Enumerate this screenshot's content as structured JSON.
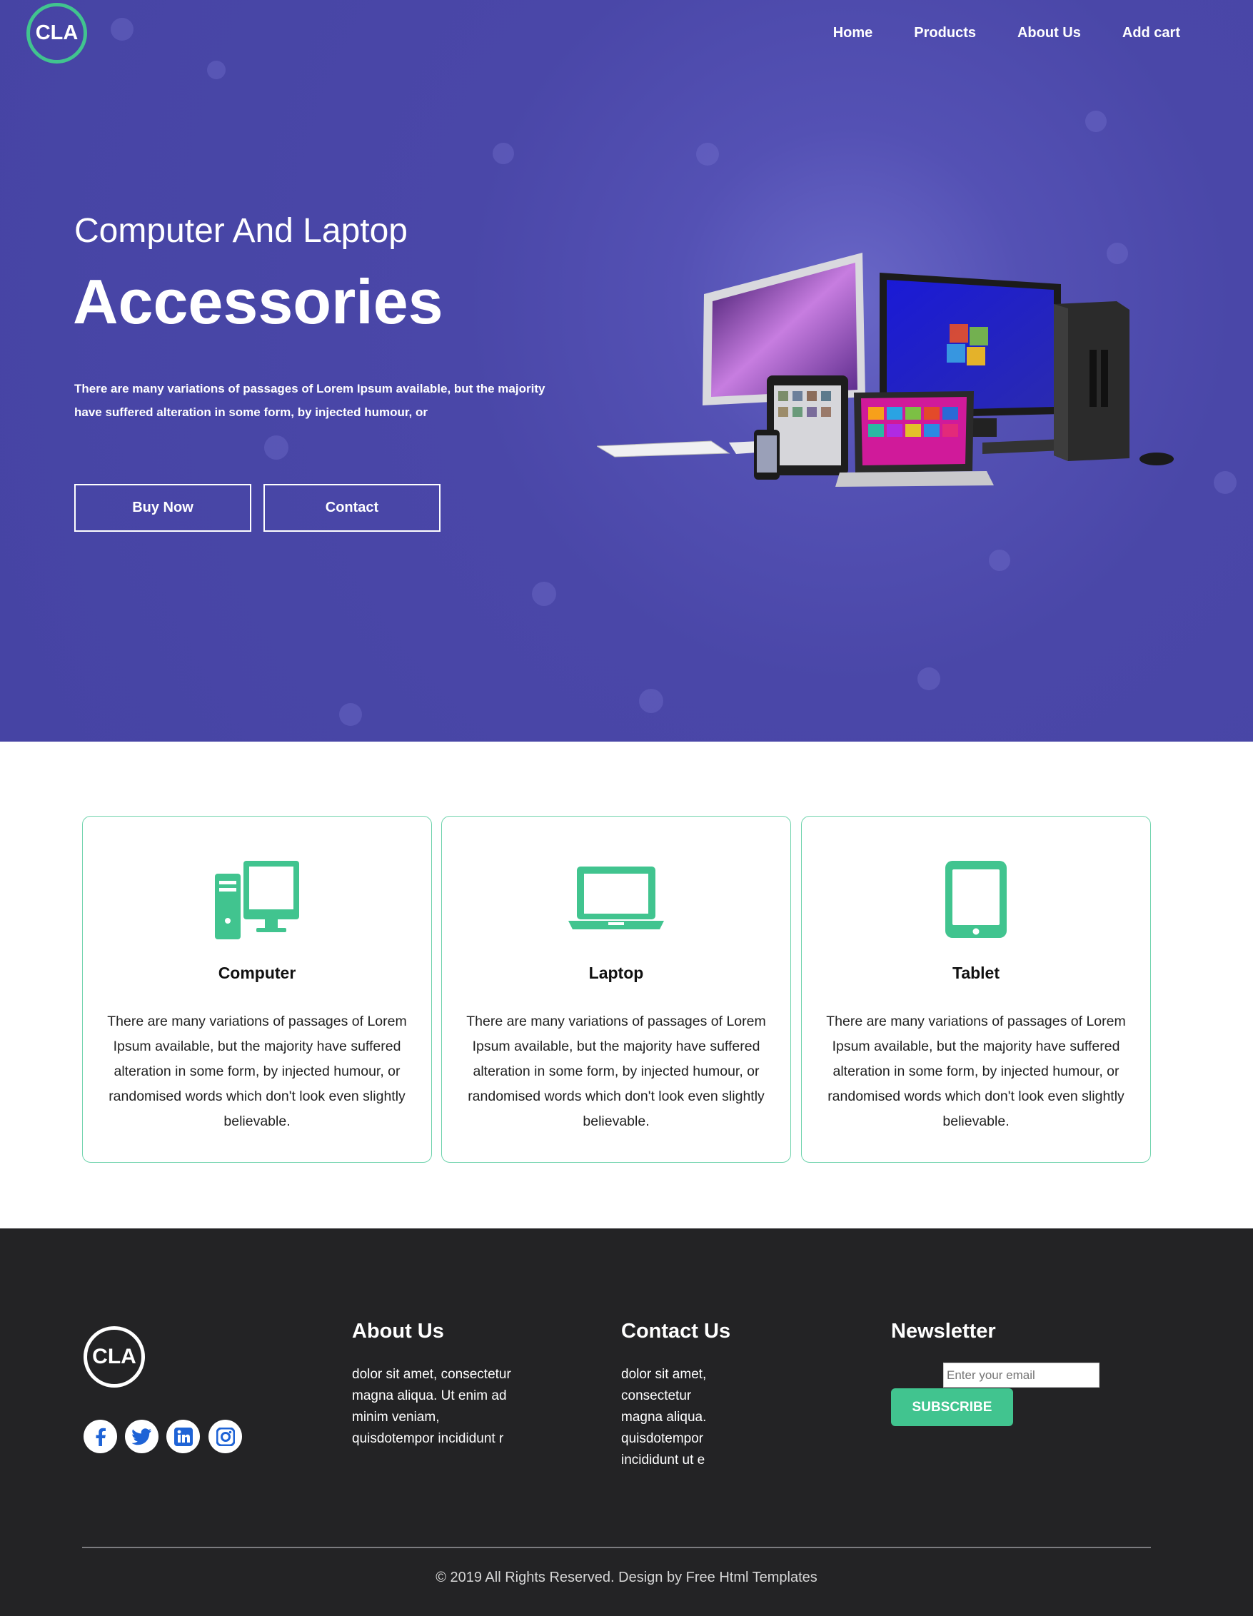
{
  "header": {
    "logo_text": "CLA",
    "nav": [
      "Home",
      "Products",
      "About Us",
      "Add cart"
    ]
  },
  "hero": {
    "subtitle": "Computer And Laptop",
    "title": "Accessories",
    "text": "There are many variations of passages of Lorem Ipsum available, but the majority have suffered alteration in some form, by injected humour, or",
    "buttons": [
      "Buy Now",
      "Contact"
    ]
  },
  "cards": [
    {
      "icon": "desktop-computer-icon",
      "title": "Computer",
      "text": "There are many variations of passages of Lorem Ipsum available, but the majority have suffered alteration in some form, by injected humour, or randomised words which don't look even slightly believable."
    },
    {
      "icon": "laptop-icon",
      "title": "Laptop",
      "text": "There are many variations of passages of Lorem Ipsum available, but the majority have suffered alteration in some form, by injected humour, or randomised words which don't look even slightly believable."
    },
    {
      "icon": "tablet-icon",
      "title": "Tablet",
      "text": "There are many variations of passages of Lorem Ipsum available, but the majority have suffered alteration in some form, by injected humour, or randomised words which don't look even slightly believable."
    }
  ],
  "footer": {
    "logo_text": "CLA",
    "social": [
      "facebook-icon",
      "twitter-icon",
      "linkedin-icon",
      "instagram-icon"
    ],
    "about": {
      "title": "About Us",
      "lines": [
        "dolor sit amet, consectetur",
        "magna aliqua. Ut enim ad",
        "minim veniam,",
        "quisdotempor incididunt r"
      ]
    },
    "contact": {
      "title": "Contact Us",
      "lines": [
        "dolor sit amet,",
        "consectetur",
        "magna aliqua.",
        "quisdotempor",
        "incididunt ut e"
      ]
    },
    "newsletter": {
      "title": "Newsletter",
      "placeholder": "Enter your email",
      "button": "SUBSCRIBE"
    },
    "copyright": "© 2019 All Rights Reserved. Design by Free Html Templates"
  },
  "colors": {
    "hero_bg": "#4644a4",
    "accent": "#41c48f",
    "footer_bg": "#232325",
    "social_icon": "#1e63d6"
  }
}
